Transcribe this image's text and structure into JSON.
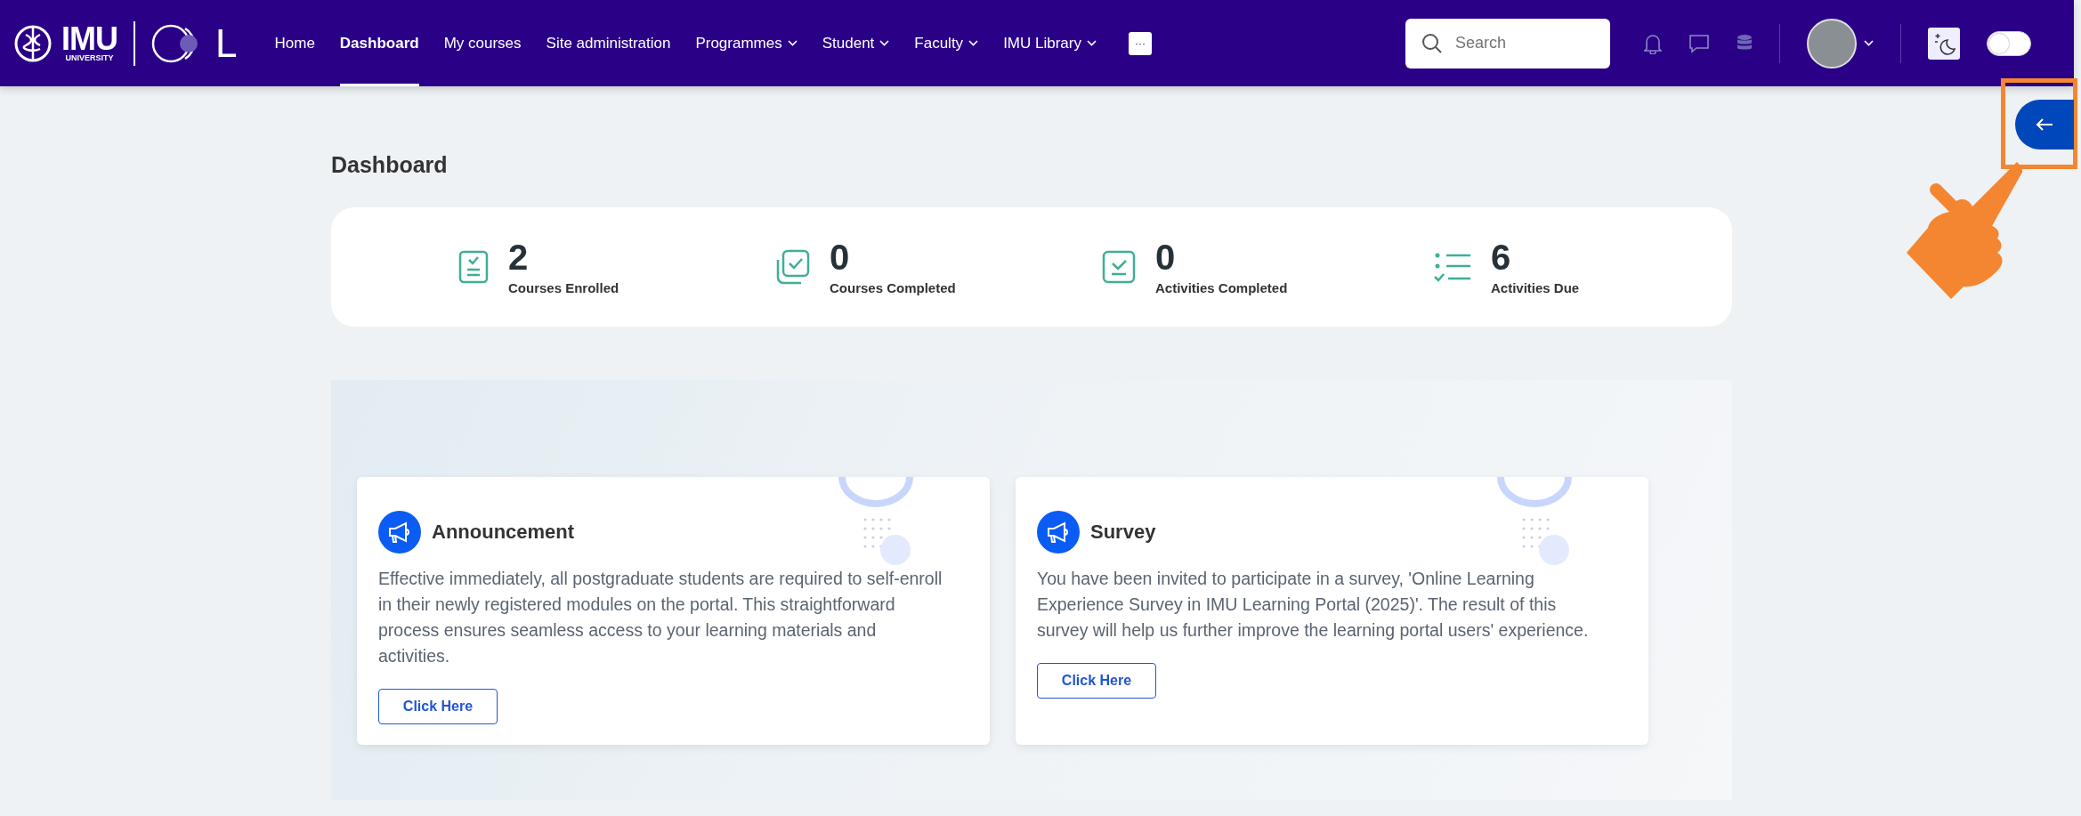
{
  "navbar": {
    "logo": {
      "wordmark": "IMU",
      "subtitle": "UNIVERSITY",
      "mark_letter": "L"
    },
    "menu": [
      {
        "label": "Home",
        "kind": "link",
        "selected": false
      },
      {
        "label": "Dashboard",
        "kind": "link",
        "selected": true
      },
      {
        "label": "My courses",
        "kind": "link",
        "selected": false
      },
      {
        "label": "Site administration",
        "kind": "link",
        "selected": false
      },
      {
        "label": "Programmes",
        "kind": "dropdown",
        "selected": false
      },
      {
        "label": "Student",
        "kind": "dropdown",
        "selected": false
      },
      {
        "label": "Faculty",
        "kind": "dropdown",
        "selected": false
      },
      {
        "label": "IMU Library",
        "kind": "dropdown",
        "selected": false
      }
    ],
    "more": "···",
    "search": {
      "placeholder": "Search"
    },
    "dark_mode_toggle": {
      "on": false
    }
  },
  "page_title": "Dashboard",
  "stats": [
    {
      "kind": "enrolled",
      "value": "2",
      "label": "Courses Enrolled"
    },
    {
      "kind": "courses_completed",
      "value": "0",
      "label": "Courses Completed"
    },
    {
      "kind": "activities_completed",
      "value": "0",
      "label": "Activities Completed"
    },
    {
      "kind": "due",
      "value": "6",
      "label": "Activities Due"
    }
  ],
  "notices": [
    {
      "title": "Announcement",
      "text": "Effective immediately, all postgraduate students are required to self-enroll in their newly registered modules on the portal. This straightforward process ensures seamless access to your learning materials and activities.",
      "button": "Click Here"
    },
    {
      "title": "Survey",
      "text": "You have been invited to participate in a survey, 'Online Learning Experience Survey in IMU Learning Portal (2025)'. The result of this survey will help us further improve the learning portal users' experience.",
      "button": "Click Here"
    }
  ]
}
